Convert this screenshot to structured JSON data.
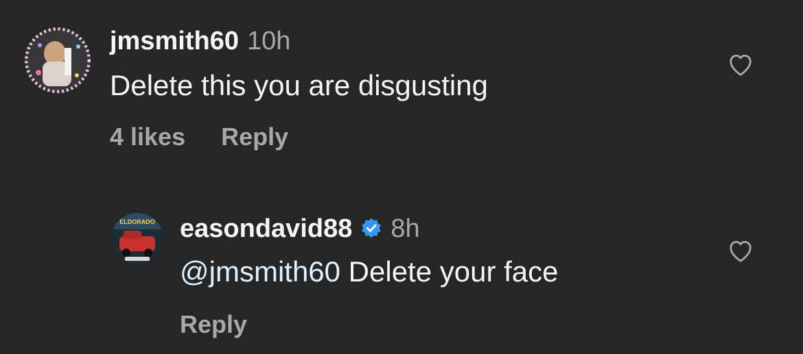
{
  "comments": [
    {
      "username": "jmsmith60",
      "time": "10h",
      "text": "Delete this you are disgusting",
      "likes": "4 likes",
      "reply_label": "Reply"
    },
    {
      "username": "easondavid88",
      "time": "8h",
      "verified": true,
      "mention": "@jmsmith60",
      "text": " Delete your face",
      "reply_label": "Reply",
      "avatar_text": "ELDORADO"
    }
  ],
  "icons": {
    "like": "heart-outline-icon",
    "verified": "verified-badge-icon"
  },
  "colors": {
    "background": "#262626",
    "primary_text": "#f5f5f5",
    "secondary_text": "#a8a8a8",
    "mention": "#e0f1ff",
    "verified_blue": "#3797f0"
  }
}
